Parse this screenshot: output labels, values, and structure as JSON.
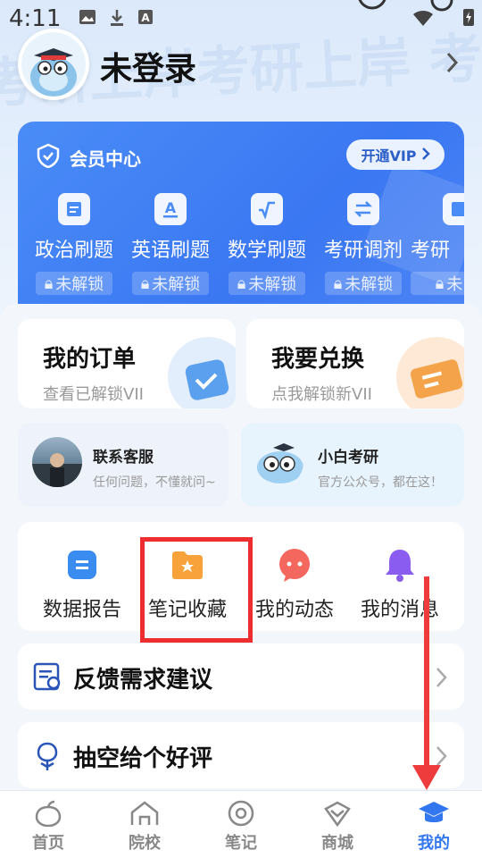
{
  "status_bar": {
    "time": "4:11"
  },
  "profile": {
    "username": "未登录"
  },
  "background_text": "考研上岸考研上岸 考研上岸考研",
  "vip": {
    "title": "会员中心",
    "open_btn": "开通VIP",
    "items": [
      {
        "label": "政治刷题",
        "lock": "未解锁",
        "icon": "document-icon"
      },
      {
        "label": "英语刷题",
        "lock": "未解锁",
        "icon": "letter-a-icon"
      },
      {
        "label": "数学刷题",
        "lock": "未解锁",
        "icon": "sqrt-icon"
      },
      {
        "label": "考研调剂",
        "lock": "未解锁",
        "icon": "swap-icon"
      },
      {
        "label": "考研",
        "lock": "未",
        "icon": "book-icon"
      }
    ]
  },
  "orders": {
    "my_order": {
      "title": "我的订单",
      "subtitle": "查看已解锁VII"
    },
    "exchange": {
      "title": "我要兑换",
      "subtitle": "点我解锁新VII"
    }
  },
  "contacts": {
    "service": {
      "title": "联系客服",
      "subtitle": "任何问题，不懂就问~"
    },
    "xiaobai": {
      "title": "小白考研",
      "subtitle": "官方公众号，都在这！"
    }
  },
  "tools": [
    {
      "label": "数据报告",
      "icon": "report-icon"
    },
    {
      "label": "笔记收藏",
      "icon": "folder-star-icon"
    },
    {
      "label": "我的动态",
      "icon": "chat-bubble-icon"
    },
    {
      "label": "我的消息",
      "icon": "bell-icon"
    }
  ],
  "rows": [
    {
      "label": "反馈需求建议",
      "icon": "feedback-icon"
    },
    {
      "label": "抽空给个好评",
      "icon": "flower-icon"
    }
  ],
  "nav": [
    {
      "label": "首页",
      "icon": "home-icon",
      "active": false
    },
    {
      "label": "院校",
      "icon": "school-icon",
      "active": false
    },
    {
      "label": "笔记",
      "icon": "notes-icon",
      "active": false
    },
    {
      "label": "商城",
      "icon": "shop-icon",
      "active": false
    },
    {
      "label": "我的",
      "icon": "graduation-cap-icon",
      "active": true
    }
  ],
  "colors": {
    "accent": "#3277f0",
    "vip_bg": "#3a77f2",
    "highlight": "#ee2e2e"
  }
}
